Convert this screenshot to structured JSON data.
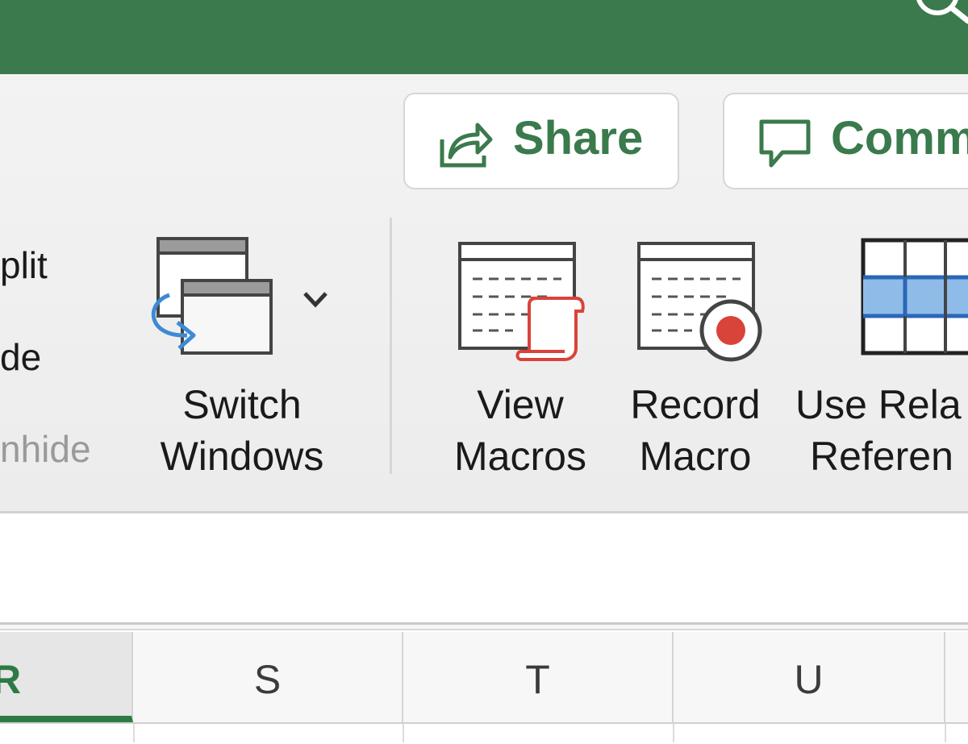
{
  "titlebar": {
    "search_icon": "search-icon",
    "accent": "#3a7a4c"
  },
  "toolbar": {
    "share_label": "Share",
    "comments_label": "Comm"
  },
  "ribbon": {
    "window_group": {
      "split_label": "plit",
      "hide_label": "de",
      "unhide_label": "nhide"
    },
    "switch_windows": {
      "line1": "Switch",
      "line2": "Windows"
    },
    "view_macros": {
      "line1": "View",
      "line2": "Macros"
    },
    "record_macro": {
      "line1": "Record",
      "line2": "Macro"
    },
    "use_relative": {
      "line1": "Use Rela",
      "line2": "Referen"
    }
  },
  "grid": {
    "columns": [
      "R",
      "S",
      "T",
      "U"
    ],
    "selected_column": "R"
  }
}
